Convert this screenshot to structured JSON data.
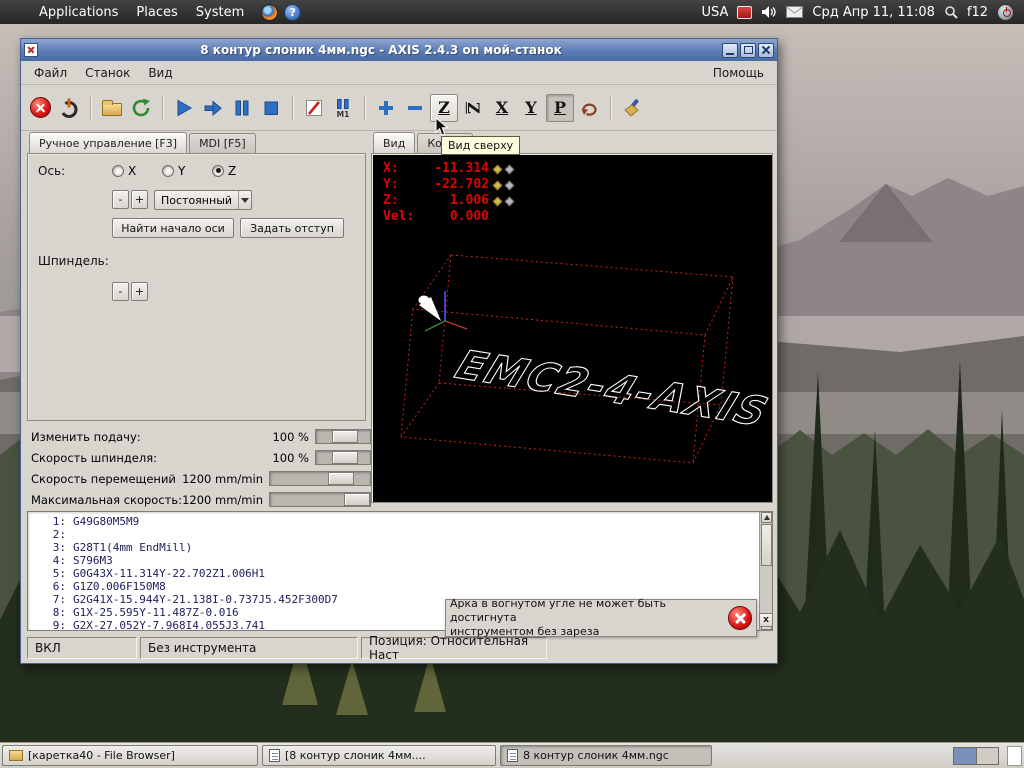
{
  "top_panel": {
    "menus": [
      {
        "label": "Applications"
      },
      {
        "label": "Places"
      },
      {
        "label": "System"
      }
    ],
    "layout_indicator": "USA",
    "clock": "Срд Апр 11, 11:08",
    "search_hotkey": "f12"
  },
  "window": {
    "title": "8  контур слоник 4мм.ngc - AXIS 2.4.3 on мой-станок",
    "menubar": [
      {
        "label": "Файл"
      },
      {
        "label": "Станок"
      },
      {
        "label": "Вид"
      }
    ],
    "menubar_right": "Помощь",
    "toolbar": {
      "m1": "M1",
      "icons": [
        "estop-icon",
        "machine-power-icon",
        "open-file-icon",
        "reload-icon",
        "run-icon",
        "step-icon",
        "pause-icon",
        "stop-icon",
        "skip-lines-icon",
        "optional-stop-icon",
        "zoom-in-icon",
        "zoom-out-icon",
        "top-view",
        "rotated-top-view",
        "side-view",
        "front-view",
        "perspective-view",
        "rotate-view-icon",
        "clear-plot-icon"
      ]
    },
    "view_buttons": [
      "Z",
      "Z",
      "X",
      "Y",
      "P"
    ],
    "tabs": [
      {
        "label": "Ручное управление [F3]"
      },
      {
        "label": "MDI [F5]"
      }
    ],
    "manual": {
      "axis_label": "Ось:",
      "axis_options": [
        "X",
        "Y",
        "Z"
      ],
      "selected_axis": "Z",
      "jog_minus": "-",
      "jog_plus": "+",
      "jog_increment": "Постоянный",
      "home_button": "Найти начало оси",
      "touch_off_button": "Задать отступ",
      "spindle_label": "Шпиндель:",
      "spindle_minus": "-",
      "spindle_plus": "+"
    },
    "overrides": [
      {
        "label": "Изменить подачу:",
        "value": "100 %"
      },
      {
        "label": "Скорость шпинделя:",
        "value": "100 %"
      },
      {
        "label": "Скорость перемещений",
        "value": "1200 mm/min"
      },
      {
        "label": "Максимальная скорость:",
        "value": "1200 mm/min"
      }
    ],
    "preview_tabs": [
      {
        "label": "Вид"
      },
      {
        "label": "Коорд"
      }
    ],
    "tooltip": "Вид сверху",
    "dro": [
      {
        "label": "X:",
        "value": "-11.314"
      },
      {
        "label": "Y:",
        "value": "-22.702"
      },
      {
        "label": "Z:",
        "value": "1.006"
      },
      {
        "label": "Vel:",
        "value": "0.000"
      }
    ],
    "preview_text": "EMC2-4-AXIS",
    "gcode": [
      {
        "n": "1:",
        "text": "G49G80M5M9"
      },
      {
        "n": "2:",
        "text": ""
      },
      {
        "n": "3:",
        "text": "G28T1(4mm EndMill)"
      },
      {
        "n": "4:",
        "text": "S796M3"
      },
      {
        "n": "5:",
        "text": "G0G43X-11.314Y-22.702Z1.006H1"
      },
      {
        "n": "6:",
        "text": "G1Z0.006F150M8"
      },
      {
        "n": "7:",
        "text": "G2G41X-15.944Y-21.138I-0.737J5.452F300D7"
      },
      {
        "n": "8:",
        "text": "G1X-25.595Y-11.487Z-0.016"
      },
      {
        "n": "9:",
        "text": "G2X-27.052Y-7.968I4.055J3.741"
      }
    ],
    "notification": {
      "line1": "Арка в вогнутом угле не может быть достигнута",
      "line2": "инструментом без зареза"
    },
    "statusbar": [
      {
        "text": "ВКЛ"
      },
      {
        "text": "Без инструмента"
      },
      {
        "text": "Позиция: Относительная Наст"
      }
    ]
  },
  "taskbar": {
    "items": [
      {
        "label": "[каретка40 - File Browser]"
      },
      {
        "label": "[8  контур слоник 4мм...."
      },
      {
        "label": "8  контур слоник 4мм.ngc"
      }
    ]
  }
}
